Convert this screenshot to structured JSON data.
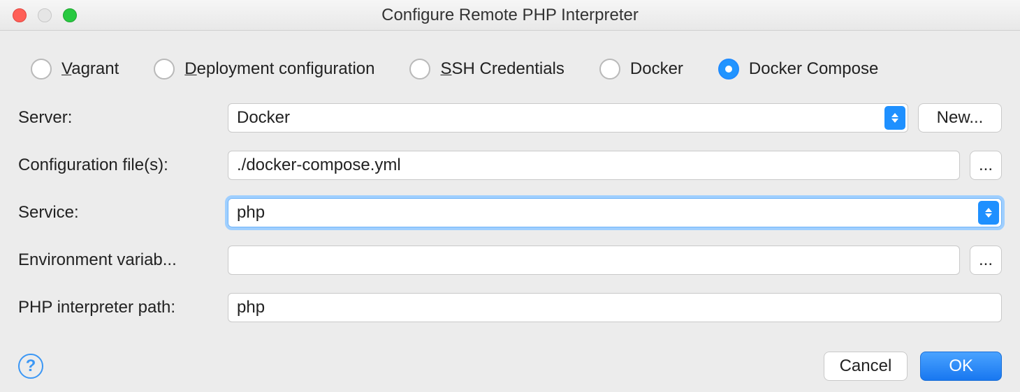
{
  "window": {
    "title": "Configure Remote PHP Interpreter"
  },
  "radios": {
    "vagrant": {
      "label": "agrant",
      "prefix": "V"
    },
    "deploy": {
      "label": "eployment configuration",
      "prefix": "D"
    },
    "ssh": {
      "label": "SH Credentials",
      "prefix": "S"
    },
    "docker": {
      "label": "Docker"
    },
    "compose": {
      "label": "Docker Compose",
      "selected": true
    }
  },
  "form": {
    "server_label": "Server:",
    "server_value": "Docker",
    "new_button": "New...",
    "config_label": "Configuration file(s):",
    "config_value": "./docker-compose.yml",
    "service_label": "Service:",
    "service_value": "php",
    "env_label": "Environment variab...",
    "env_value": "",
    "path_label": "PHP interpreter path:",
    "path_value": "php",
    "browse": "..."
  },
  "footer": {
    "help": "?",
    "cancel": "Cancel",
    "ok": "OK"
  }
}
